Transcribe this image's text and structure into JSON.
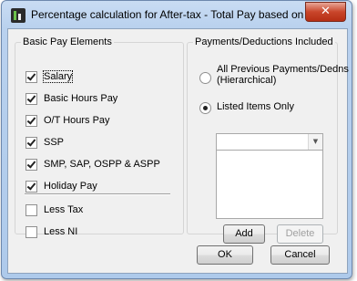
{
  "window": {
    "title": "Percentage calculation for After-tax - Total Pay based on...",
    "close_label": "✕"
  },
  "basic_pay": {
    "legend": "Basic Pay Elements",
    "items": [
      {
        "label": "Salary",
        "checked": true
      },
      {
        "label": "Basic Hours Pay",
        "checked": true
      },
      {
        "label": "O/T Hours Pay",
        "checked": true
      },
      {
        "label": "SSP",
        "checked": true
      },
      {
        "label": "SMP, SAP, OSPP & ASPP",
        "checked": true
      },
      {
        "label": "Holiday Pay",
        "checked": true
      }
    ],
    "less_items": [
      {
        "label": "Less Tax",
        "checked": false
      },
      {
        "label": "Less NI",
        "checked": false
      }
    ]
  },
  "payments": {
    "legend": "Payments/Deductions Included",
    "option_all": "All Previous Payments/Dedns (Hierarchical)",
    "option_all_line1": "All Previous Payments/Dedns",
    "option_all_line2": "(Hierarchical)",
    "option_listed": "Listed Items Only",
    "selected": "Listed Items Only",
    "combo_value": "",
    "add_label": "Add",
    "delete_label": "Delete"
  },
  "footer": {
    "ok_label": "OK",
    "cancel_label": "Cancel"
  }
}
